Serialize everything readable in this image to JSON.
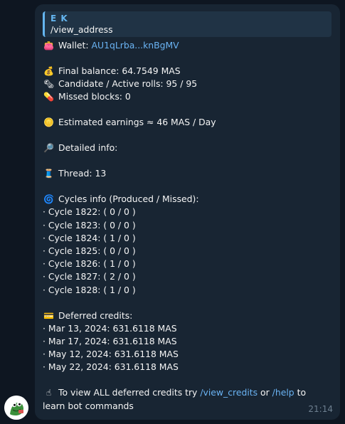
{
  "reply": {
    "author": "E K",
    "text": "/view_address"
  },
  "wallet": {
    "emoji": "👛",
    "label": "Wallet: ",
    "address": "AU1qLrba...knBgMV"
  },
  "balance": {
    "emoji": "💰",
    "text": "Final balance: 64.7549 MAS"
  },
  "rolls": {
    "emoji": "🗞",
    "text": "Candidate / Active rolls: 95 / 95"
  },
  "missed": {
    "emoji": "💊",
    "text": "Missed blocks: 0"
  },
  "earnings": {
    "emoji": "🪙",
    "text": "Estimated earnings ≈ 46 MAS / Day"
  },
  "detailed": {
    "emoji": "🔎",
    "text": "Detailed info:"
  },
  "thread": {
    "emoji": "🧵",
    "text": "Thread: 13"
  },
  "cycles": {
    "emoji": "🌀",
    "title": "Cycles info (Produced / Missed):",
    "items": [
      "· Cycle 1822: ( 0 / 0 )",
      "· Cycle 1823: ( 0 / 0 )",
      "· Cycle 1824: ( 1 / 0 )",
      "· Cycle 1825: ( 0 / 0 )",
      "· Cycle 1826: ( 1 / 0 )",
      "· Cycle 1827: ( 2 / 0 )",
      "· Cycle 1828: ( 1 / 0 )"
    ]
  },
  "credits": {
    "emoji": "💳",
    "title": "Deferred credits:",
    "items": [
      "· Mar 13, 2024: 631.6118 MAS",
      "· Mar 17, 2024: 631.6118 MAS",
      "· May 12, 2024: 631.6118 MAS",
      "· May 22, 2024: 631.6118 MAS"
    ]
  },
  "footer": {
    "emoji": "☝",
    "prefix": "To view ALL deferred credits try ",
    "link1": "/view_credits",
    "middle": " or ",
    "link2": "/help",
    "suffix": " to learn bot commands"
  },
  "time": "21:14",
  "avatar_icon": "frog-avatar-icon",
  "colors": {
    "background": "#0e1621",
    "bubble": "#182533",
    "link": "#6ab3f3",
    "reply_accent": "#64b5ef"
  }
}
